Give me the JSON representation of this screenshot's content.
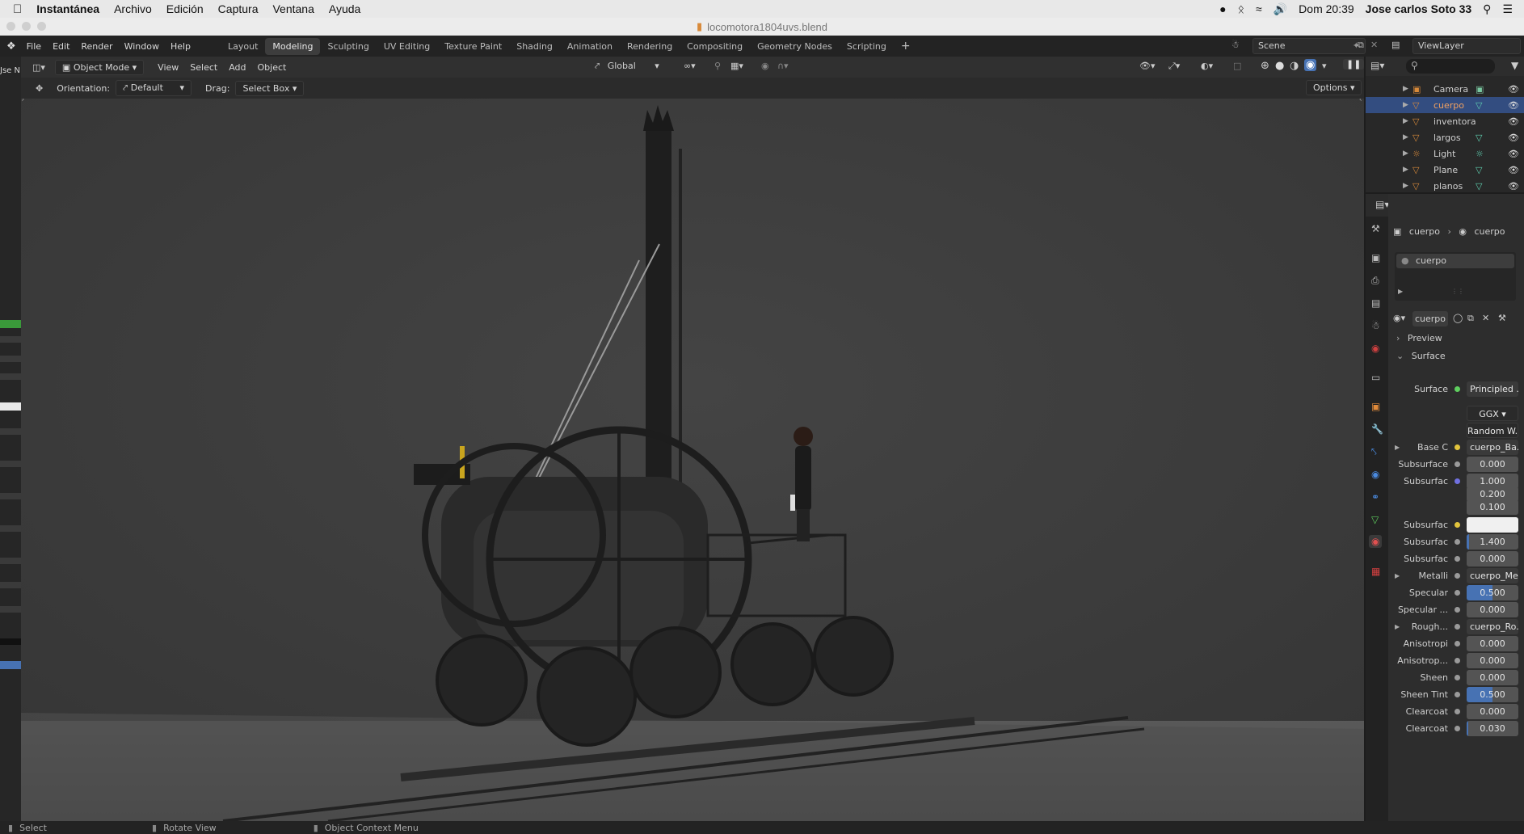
{
  "mac_menu": {
    "app_name": "Instantánea",
    "items": [
      "Archivo",
      "Edición",
      "Captura",
      "Ventana",
      "Ayuda"
    ],
    "clock": "Dom 20:39",
    "user": "Jose carlos Soto 33"
  },
  "window": {
    "title": "locomotora1804uvs.blend"
  },
  "topbar": {
    "menus": [
      "File",
      "Edit",
      "Render",
      "Window",
      "Help"
    ],
    "workspaces": [
      "Layout",
      "Modeling",
      "Sculpting",
      "UV Editing",
      "Texture Paint",
      "Shading",
      "Animation",
      "Rendering",
      "Compositing",
      "Geometry Nodes",
      "Scripting"
    ],
    "active_workspace": "Modeling",
    "add_symbol": "+",
    "scene": "Scene",
    "view_layer": "ViewLayer"
  },
  "viewport_header": {
    "mode": "Object Mode",
    "menus": [
      "View",
      "Select",
      "Add",
      "Object"
    ],
    "transform_orientation": "Global"
  },
  "tool_settings": {
    "orientation_label": "Orientation:",
    "orientation_value": "Default",
    "drag_label": "Drag:",
    "drag_value": "Select Box",
    "options": "Options"
  },
  "left_sidebar_label": "Jse N",
  "outliner": {
    "items": [
      {
        "name": "Camera",
        "selected": false
      },
      {
        "name": "cuerpo",
        "selected": true
      },
      {
        "name": "inventora",
        "selected": false
      },
      {
        "name": "largos",
        "selected": false
      },
      {
        "name": "Light",
        "selected": false
      },
      {
        "name": "Plane",
        "selected": false
      },
      {
        "name": "planos",
        "selected": false
      }
    ]
  },
  "properties": {
    "breadcrumb_object": "cuerpo",
    "breadcrumb_material": "cuerpo",
    "material_slot": "cuerpo",
    "material_name": "cuerpo",
    "panel_preview": "Preview",
    "panel_surface": "Surface",
    "rows": [
      {
        "label": "Surface",
        "value": "Principled ...",
        "dot": "grn",
        "kind": "link"
      },
      {
        "label": "",
        "value": "GGX",
        "dot": "",
        "kind": "dropdown"
      },
      {
        "label": "",
        "value": "Random W...",
        "dot": "",
        "kind": "dropdown"
      },
      {
        "label": "Base C",
        "value": "cuerpo_Ba...",
        "dot": "yel",
        "kind": "link",
        "expand": true
      },
      {
        "label": "Subsurface",
        "value": "0.000",
        "dot": "gray",
        "kind": "num",
        "fill": 0
      },
      {
        "label": "Subsurfac",
        "value": "1.000",
        "dot": "blu",
        "kind": "num",
        "fill": 0
      },
      {
        "label": "",
        "value": "0.200",
        "dot": "",
        "kind": "num",
        "fill": 0
      },
      {
        "label": "",
        "value": "0.100",
        "dot": "",
        "kind": "num",
        "fill": 0
      },
      {
        "label": "Subsurfac",
        "value": "",
        "dot": "yel",
        "kind": "color"
      },
      {
        "label": "Subsurfac",
        "value": "1.400",
        "dot": "gray",
        "kind": "num",
        "fill": 5
      },
      {
        "label": "Subsurfac",
        "value": "0.000",
        "dot": "gray",
        "kind": "num",
        "fill": 0
      },
      {
        "label": "Metalli",
        "value": "cuerpo_Me...",
        "dot": "gray",
        "kind": "link",
        "expand": true
      },
      {
        "label": "Specular",
        "value": "0.500",
        "dot": "gray",
        "kind": "num",
        "fill": 50
      },
      {
        "label": "Specular ...",
        "value": "0.000",
        "dot": "gray",
        "kind": "num",
        "fill": 0
      },
      {
        "label": "Rough...",
        "value": "cuerpo_Ro...",
        "dot": "gray",
        "kind": "link",
        "expand": true
      },
      {
        "label": "Anisotropi",
        "value": "0.000",
        "dot": "gray",
        "kind": "num",
        "fill": 0
      },
      {
        "label": "Anisotrop...",
        "value": "0.000",
        "dot": "gray",
        "kind": "num",
        "fill": 0
      },
      {
        "label": "Sheen",
        "value": "0.000",
        "dot": "gray",
        "kind": "num",
        "fill": 0
      },
      {
        "label": "Sheen Tint",
        "value": "0.500",
        "dot": "gray",
        "kind": "num",
        "fill": 50
      },
      {
        "label": "Clearcoat",
        "value": "0.000",
        "dot": "gray",
        "kind": "num",
        "fill": 0
      },
      {
        "label": "Clearcoat",
        "value": "0.030",
        "dot": "gray",
        "kind": "num",
        "fill": 3
      }
    ]
  },
  "statusbar": {
    "items": [
      "Select",
      "Rotate View",
      "Object Context Menu"
    ]
  },
  "colors": {
    "selection": "#334d80",
    "accent_blue": "#4772b3",
    "viewport_bg": "#3d3d3d",
    "floor": "#4a4a4a"
  }
}
